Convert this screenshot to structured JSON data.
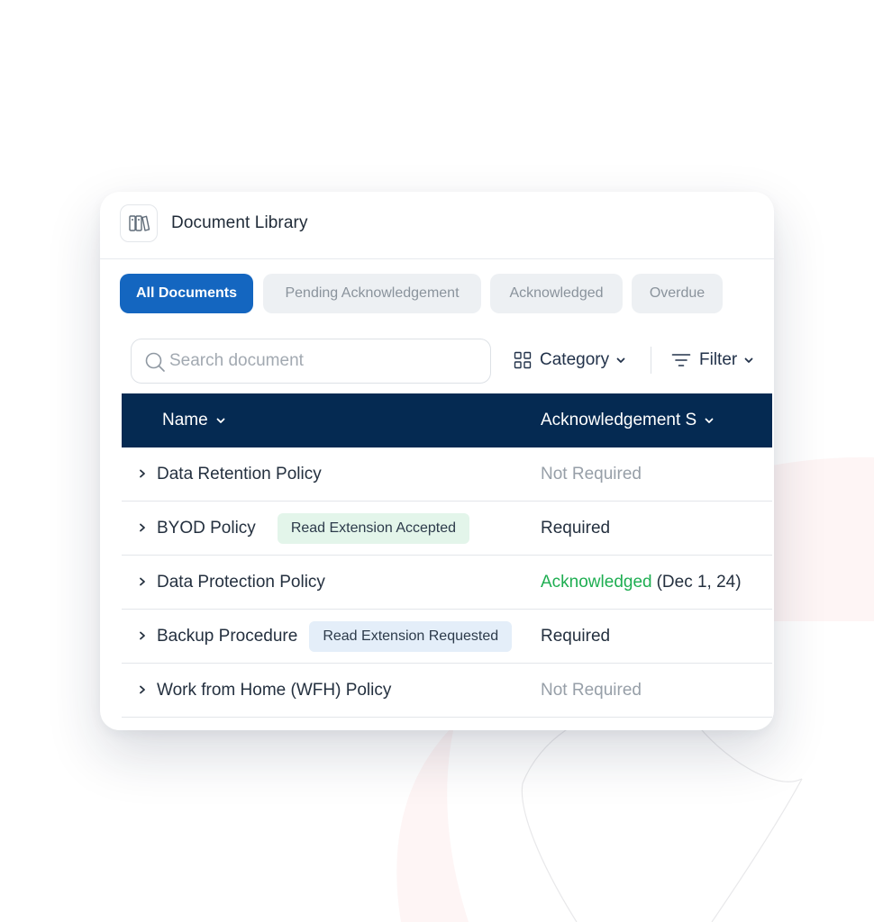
{
  "header": {
    "title": "Document Library",
    "icon": "books-icon"
  },
  "tabs": [
    {
      "label": "All Documents",
      "active": true
    },
    {
      "label": "Pending Acknowledgement",
      "active": false
    },
    {
      "label": "Acknowledged",
      "active": false
    },
    {
      "label": "Overdue",
      "active": false
    }
  ],
  "toolbar": {
    "search_placeholder": "Search document",
    "search_value": "",
    "category_label": "Category",
    "filter_label": "Filter"
  },
  "table": {
    "columns": [
      {
        "label": "Name"
      },
      {
        "label": "Acknowledgement S"
      }
    ],
    "rows": [
      {
        "name": "Data Retention Policy",
        "badge": "",
        "status": "Not Required",
        "date": ""
      },
      {
        "name": "BYOD Policy",
        "badge": "Read Extension Accepted",
        "status": "Required",
        "date": ""
      },
      {
        "name": "Data Protection Policy",
        "badge": "",
        "status": "Acknowledged",
        "date": "(Dec 1, 24)"
      },
      {
        "name": "Backup Procedure",
        "badge": "Read Extension Requested",
        "status": "Required",
        "date": ""
      },
      {
        "name": "Work from Home (WFH) Policy",
        "badge": "",
        "status": "Not Required",
        "date": ""
      }
    ]
  },
  "colors": {
    "primary": "#1466c0",
    "table_header": "#052a52",
    "acknowledged": "#1fae52",
    "muted": "#979fa8",
    "badge_green": "#e3f5ea",
    "badge_blue": "#e4eef9"
  }
}
